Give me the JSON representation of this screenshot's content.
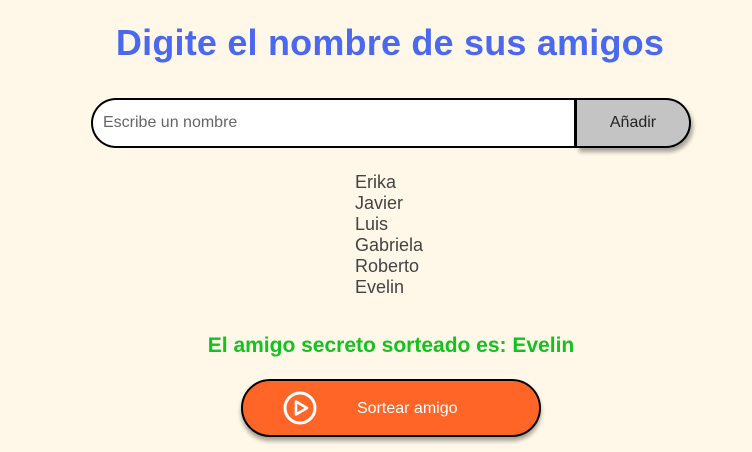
{
  "header": {
    "title": "Digite el nombre de sus amigos"
  },
  "input": {
    "placeholder": "Escribe un nombre",
    "value": ""
  },
  "add_button": {
    "label": "Añadir"
  },
  "friends": [
    "Erika",
    "Javier",
    "Luis",
    "Gabriela",
    "Roberto",
    "Evelin"
  ],
  "result": {
    "text": "El amigo secreto sorteado es: Evelin"
  },
  "draw_button": {
    "label": "Sortear amigo",
    "icon": "play-circle-icon"
  },
  "colors": {
    "background": "#fff8e8",
    "title": "#4b69f0",
    "result": "#13c21e",
    "draw_button": "#ff6527",
    "add_button": "#c4c4c4"
  }
}
